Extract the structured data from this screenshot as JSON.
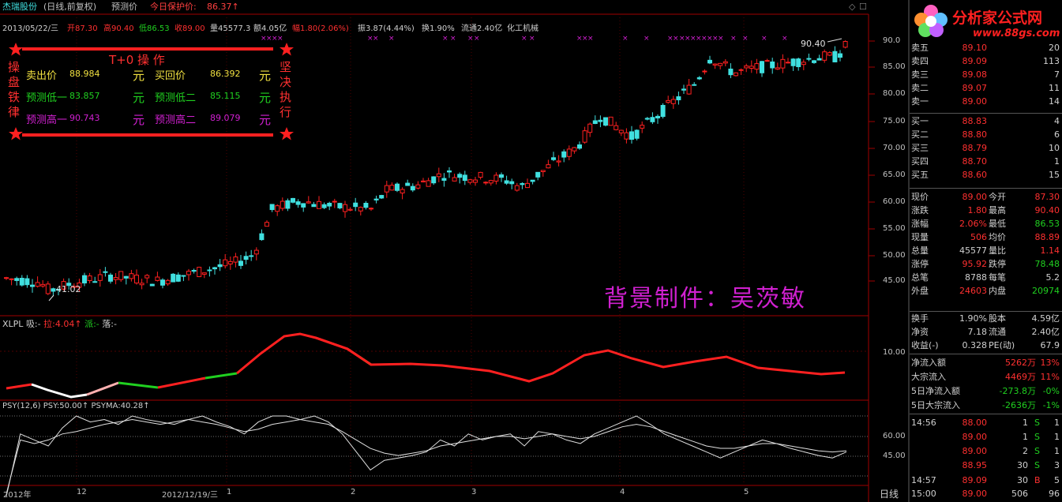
{
  "header": {
    "stock_name": "杰瑞股份",
    "mode": "(日线,前复权)",
    "indicator_name": "预测价",
    "protect_label": "今日保护价:",
    "protect_value": "86.37↑"
  },
  "quote": {
    "date": "2013/05/22/三",
    "open": "开87.30",
    "high": "高90.40",
    "low": "低86.53",
    "close": "收89.00",
    "volume": "量45577.3",
    "amount": "额4.05亿",
    "change": "幅1.80(2.06%)",
    "amplitude": "振3.87(4.44%)",
    "turnover": "换1.90%",
    "float": "流通2.40亿",
    "sector": "化工机械"
  },
  "overlay": {
    "title": "T+0 操 作",
    "left_vertical": "操盘铁律",
    "right_vertical": "坚决执行",
    "rows": [
      {
        "l1": "卖出价",
        "v1": "88.984",
        "u1": "元",
        "l2": "买回价",
        "v2": "86.392",
        "u2": "元"
      },
      {
        "l1": "预测低一",
        "v1": "83.857",
        "u1": "元",
        "l2": "预测低二",
        "v2": "85.115",
        "u2": "元"
      },
      {
        "l1": "预测高一",
        "v1": "90.743",
        "u1": "元",
        "l2": "预测高二",
        "v2": "89.079",
        "u2": "元"
      }
    ],
    "colors": {
      "row0": "#f0e040",
      "row1": "#20d020",
      "row2": "#d020d0",
      "title": "#ff3030",
      "vertical": "#ff3030"
    }
  },
  "watermark": "背景制件：吴茨敏",
  "price_labels": {
    "high_mark": "90.40",
    "low_mark": "41.02"
  },
  "axes": {
    "price_ticks": [
      "90.0",
      "85.00",
      "80.00",
      "75.00",
      "70.00",
      "65.00",
      "60.00",
      "55.00",
      "50.00",
      "45.00"
    ],
    "xlpl_ticks": [
      "10.00"
    ],
    "psy_ticks": [
      "60.00",
      "45.00"
    ],
    "time_labels": [
      "2012年",
      "12",
      "2012/12/19/三",
      "1",
      "2",
      "3",
      "4",
      "5"
    ],
    "period_label": "日线"
  },
  "xlpl": {
    "name": "XLPL",
    "s1": "吸:",
    "v1": "-",
    "s2": "拉:",
    "v2": "4.04↑",
    "s3": "派:",
    "v3": "-",
    "s4": "落:",
    "v4": "-"
  },
  "psy": {
    "name": "PSY(12,6)",
    "psy_label": "PSY:",
    "psy_value": "50.00↑",
    "ma_label": "PSYMA:",
    "ma_value": "40.28↑"
  },
  "logo": {
    "text": "分析家公式网",
    "url": "www.88gs.com"
  },
  "orderbook": [
    {
      "label": "卖五",
      "price": "89.10",
      "vol": "20"
    },
    {
      "label": "卖四",
      "price": "89.09",
      "vol": "113"
    },
    {
      "label": "卖三",
      "price": "89.08",
      "vol": "7"
    },
    {
      "label": "卖二",
      "price": "89.07",
      "vol": "11"
    },
    {
      "label": "卖一",
      "price": "89.00",
      "vol": "14"
    },
    {
      "label": "买一",
      "price": "88.83",
      "vol": "4"
    },
    {
      "label": "买二",
      "price": "88.80",
      "vol": "6"
    },
    {
      "label": "买三",
      "price": "88.79",
      "vol": "10"
    },
    {
      "label": "买四",
      "price": "88.70",
      "vol": "1"
    },
    {
      "label": "买五",
      "price": "88.60",
      "vol": "15"
    }
  ],
  "stats": [
    {
      "l1": "现价",
      "v1": "89.00",
      "c1": "#ff3030",
      "l2": "今开",
      "v2": "87.30",
      "c2": "#ff3030"
    },
    {
      "l1": "涨跌",
      "v1": "1.80",
      "c1": "#ff3030",
      "l2": "最高",
      "v2": "90.40",
      "c2": "#ff3030"
    },
    {
      "l1": "涨幅",
      "v1": "2.06%",
      "c1": "#ff3030",
      "l2": "最低",
      "v2": "86.53",
      "c2": "#20d020"
    },
    {
      "l1": "现量",
      "v1": "506",
      "c1": "#ff3030",
      "l2": "均价",
      "v2": "88.89",
      "c2": "#ff3030"
    },
    {
      "l1": "总量",
      "v1": "45577",
      "c1": "#d0d0d0",
      "l2": "量比",
      "v2": "1.14",
      "c2": "#ff3030"
    },
    {
      "l1": "涨停",
      "v1": "95.92",
      "c1": "#ff3030",
      "l2": "跌停",
      "v2": "78.48",
      "c2": "#20d020"
    },
    {
      "l1": "总笔",
      "v1": "8788",
      "c1": "#d0d0d0",
      "l2": "每笔",
      "v2": "5.2",
      "c2": "#d0d0d0"
    },
    {
      "l1": "外盘",
      "v1": "24603",
      "c1": "#ff3030",
      "l2": "内盘",
      "v2": "20974",
      "c2": "#20d020"
    }
  ],
  "stats2": [
    {
      "l1": "换手",
      "v1": "1.90%",
      "l2": "股本",
      "v2": "4.59亿"
    },
    {
      "l1": "净资",
      "v1": "7.18",
      "l2": "流通",
      "v2": "2.40亿"
    },
    {
      "l1": "收益(-)",
      "v1": "0.328",
      "l2": "PE(动)",
      "v2": "67.9"
    }
  ],
  "flows": [
    {
      "label": "净流入额",
      "value": "5262万",
      "pct": "13%",
      "color": "#ff3030"
    },
    {
      "label": "大宗流入",
      "value": "4469万",
      "pct": "11%",
      "color": "#ff3030"
    },
    {
      "label": "5日净流入额",
      "value": "-273.8万",
      "pct": "-0%",
      "color": "#20d020"
    },
    {
      "label": "5日大宗流入",
      "value": "-2636万",
      "pct": "-1%",
      "color": "#20d020"
    }
  ],
  "ticks": [
    {
      "time": "14:56",
      "price": "88.00",
      "vol": "1",
      "bs": "S",
      "n": "1"
    },
    {
      "time": "",
      "price": "89.00",
      "vol": "1",
      "bs": "S",
      "n": "1"
    },
    {
      "time": "",
      "price": "89.00",
      "vol": "2",
      "bs": "S",
      "n": "1"
    },
    {
      "time": "",
      "price": "88.95",
      "vol": "30",
      "bs": "S",
      "n": "3"
    },
    {
      "time": "14:57",
      "price": "89.09",
      "vol": "30",
      "bs": "B",
      "n": "5"
    },
    {
      "time": "15:00",
      "price": "89.00",
      "vol": "506",
      "bs": "",
      "n": "96"
    }
  ],
  "colors": {
    "up": "#ff2020",
    "down": "#40e0e0",
    "grid": "#800000",
    "axis": "#a00000",
    "label": "#c0c0c0",
    "green": "#20d020",
    "yellow": "#f0e040",
    "magenta": "#d020d0"
  }
}
